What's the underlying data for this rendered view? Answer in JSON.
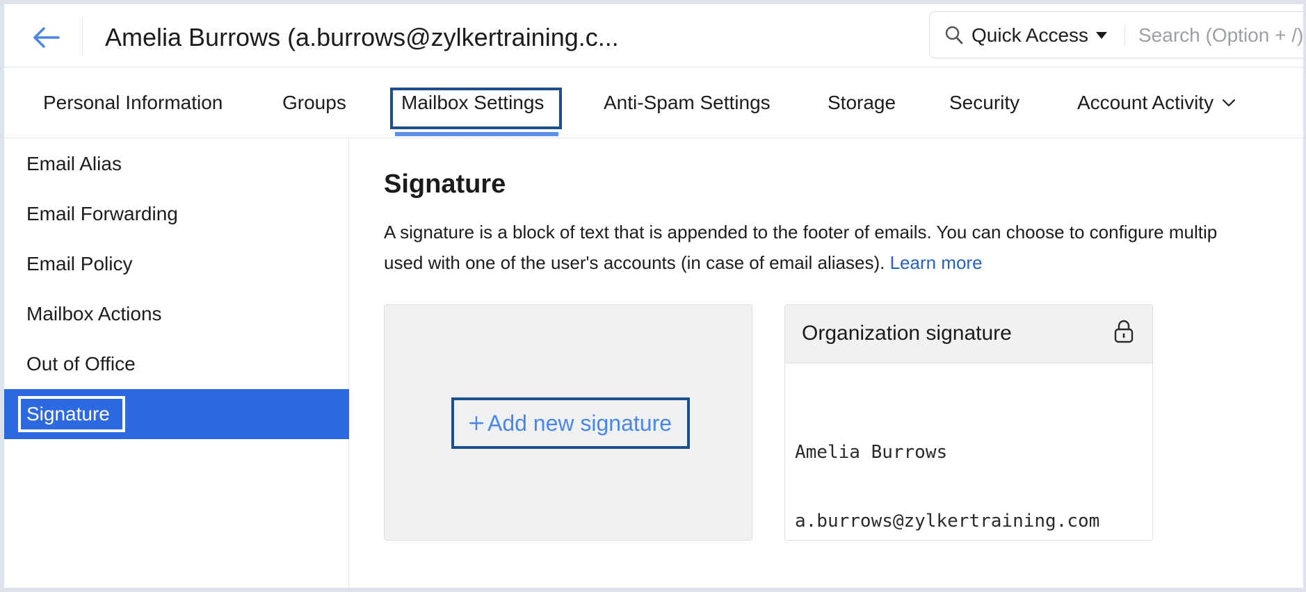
{
  "header": {
    "title": "Amelia Burrows (a.burrows@zylkertraining.c...",
    "quick_access_label": "Quick Access",
    "search_placeholder": "Search (Option + /)"
  },
  "tabs": [
    {
      "label": "Personal Information"
    },
    {
      "label": "Groups"
    },
    {
      "label": "Mailbox Settings",
      "active": true
    },
    {
      "label": "Anti-Spam Settings"
    },
    {
      "label": "Storage"
    },
    {
      "label": "Security"
    },
    {
      "label": "Account Activity",
      "has_dropdown": true
    }
  ],
  "sidebar": {
    "items": [
      {
        "label": "Email Alias"
      },
      {
        "label": "Email Forwarding"
      },
      {
        "label": "Email Policy"
      },
      {
        "label": "Mailbox Actions"
      },
      {
        "label": "Out of Office"
      },
      {
        "label": "Signature",
        "active": true
      }
    ]
  },
  "main": {
    "title": "Signature",
    "description": "A signature is a block of text that is appended to the footer of emails. You can choose to configure multip used with one of the user's accounts (in case of email aliases).",
    "description_line1": "A signature is a block of text that is appended to the footer of emails. You can choose to configure multip",
    "description_line2": "used with one of the user's accounts (in case of email aliases).",
    "learn_more": "Learn more",
    "add_signature_label": "Add new signature",
    "org_signature": {
      "title": "Organization signature",
      "line1": "Amelia Burrows",
      "line2": "a.burrows@zylkertraining.com"
    }
  },
  "colors": {
    "accent": "#2d69e0",
    "highlight_border": "#1d4f8c",
    "link": "#2360c8",
    "tab_underline": "#5e8fea"
  },
  "icons": [
    "back-arrow-icon",
    "search-icon",
    "caret-down-icon",
    "chevron-down-icon",
    "plus-icon",
    "lock-icon"
  ]
}
